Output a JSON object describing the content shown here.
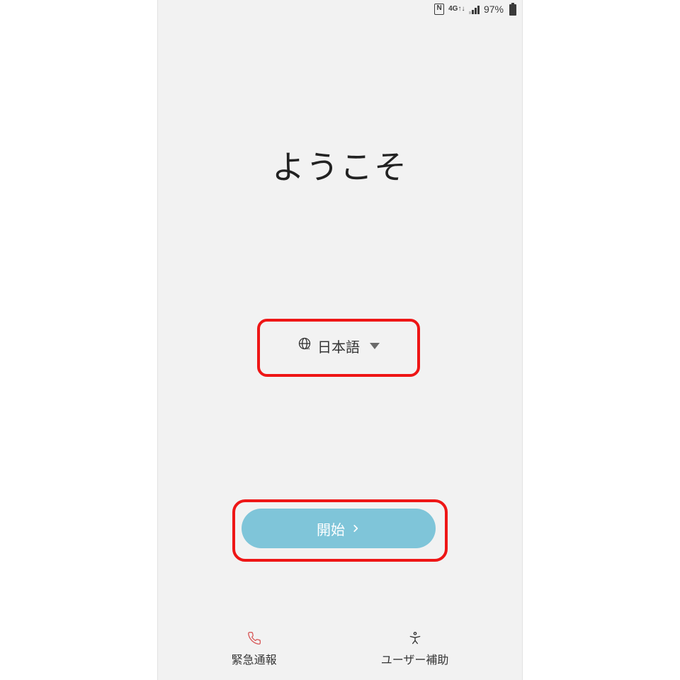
{
  "statusbar": {
    "nfc_label": "N",
    "net_label_top": "4G",
    "net_label_bottom": "↑↓",
    "battery_pct": "97%"
  },
  "welcome_heading": "ようこそ",
  "language_selector": {
    "current": "日本語"
  },
  "start_button": {
    "label": "開始"
  },
  "bottom_actions": {
    "emergency": {
      "label": "緊急通報"
    },
    "accessibility": {
      "label": "ユーザー補助"
    }
  }
}
